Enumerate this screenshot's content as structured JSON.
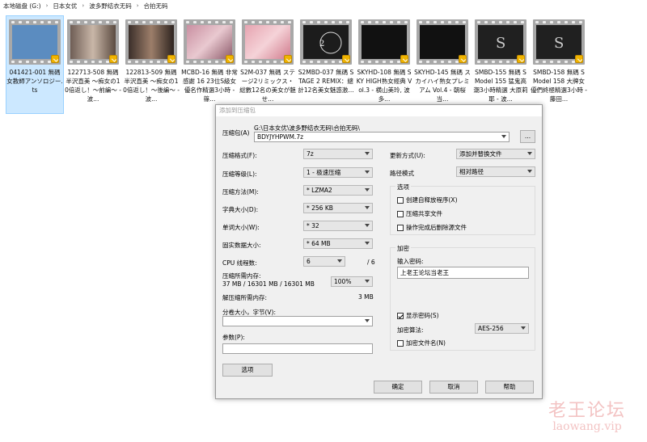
{
  "breadcrumb": [
    "本地磁盘 (G:)",
    "日本女优",
    "波多野结衣无码",
    "合拍无码"
  ],
  "files": [
    {
      "label": "041421-001 無碼 女教師アンソロジー.ts",
      "selected": true
    },
    {
      "label": "122713-508 無碼 半沢直美 ～痴女の10倍返し！～前編～ - 波...",
      "selected": false
    },
    {
      "label": "122813-509 無碼 半沢直美 ～痴女の10倍返し！～後編～ - 波...",
      "selected": false
    },
    {
      "label": "MCBD-16 無碼 非常感謝 16 23位S級女優名作精選3小時 - 篠...",
      "selected": false
    },
    {
      "label": "S2M-037 無碼 ステージ2リミックス・総數12名の美女が魅せ...",
      "selected": false
    },
    {
      "label": "S2MBD-037 無碼 STAGE 2 REMIX：總計12名美女魅惑激...",
      "selected": false
    },
    {
      "label": "SKYHD-108 無碼 SKY HIGH熟女經典 Vol.3 - 横山美玲, 波多...",
      "selected": false
    },
    {
      "label": "SKYHD-145 無碼 スカイハイ熟女プレミアム Vol.4 - 朝桜当...",
      "selected": false
    },
    {
      "label": "SMBD-155 無碼 S Model 155 猛鬼高潮3小時精選 大原莉耶 - 波...",
      "selected": false
    },
    {
      "label": "SMBD-158 無碼 S Model 158 大牌女優們終極精選3小時 - 藤田...",
      "selected": false
    }
  ],
  "dialog": {
    "title": "添加到压缩包",
    "archive_label": "压缩包(A)",
    "archive_path": "G:\\日本女优\\波多野结衣无码\\合拍无码\\",
    "archive_name": "BDYJYHPWM.7z",
    "browse_label": "...",
    "format_label": "压缩格式(F):",
    "format_value": "7z",
    "level_label": "压缩等级(L):",
    "level_value": "1 - 极速压缩",
    "method_label": "压缩方法(M):",
    "method_value": "* LZMA2",
    "dict_label": "字典大小(D):",
    "dict_value": "* 256 KB",
    "word_label": "单词大小(W):",
    "word_value": "* 32",
    "solid_label": "固实数据大小:",
    "solid_value": "* 64 MB",
    "cpu_label": "CPU 线程数:",
    "cpu_value": "6",
    "cpu_total": "/ 6",
    "mem_label": "压缩所需内存:",
    "mem_detail": "37 MB / 16301 MB / 16301 MB",
    "mem_percent": "100%",
    "demem_label": "解压缩所需内存:",
    "demem_value": "3 MB",
    "split_label": "分卷大小，字节(V):",
    "split_value": "",
    "params_label": "参数(P):",
    "params_value": "",
    "options_button": "选项",
    "update_label": "更新方式(U):",
    "update_value": "添加并替换文件",
    "path_label": "路径模式",
    "path_value": "相对路径",
    "options_group": "选项",
    "opt_sfx": "创建自释放程序(X)",
    "opt_shared": "压缩共享文件",
    "opt_delete": "操作完成后删除源文件",
    "encrypt_group": "加密",
    "password_label": "输入密码:",
    "password_value": "上老王论坛当老王",
    "show_password": "显示密码(S)",
    "method_enc_label": "加密算法:",
    "method_enc_value": "AES-256",
    "encrypt_names": "加密文件名(N)",
    "ok": "确定",
    "cancel": "取消",
    "help": "帮助"
  },
  "watermark": {
    "brand": "老王论坛",
    "url": "laowang.vip"
  }
}
